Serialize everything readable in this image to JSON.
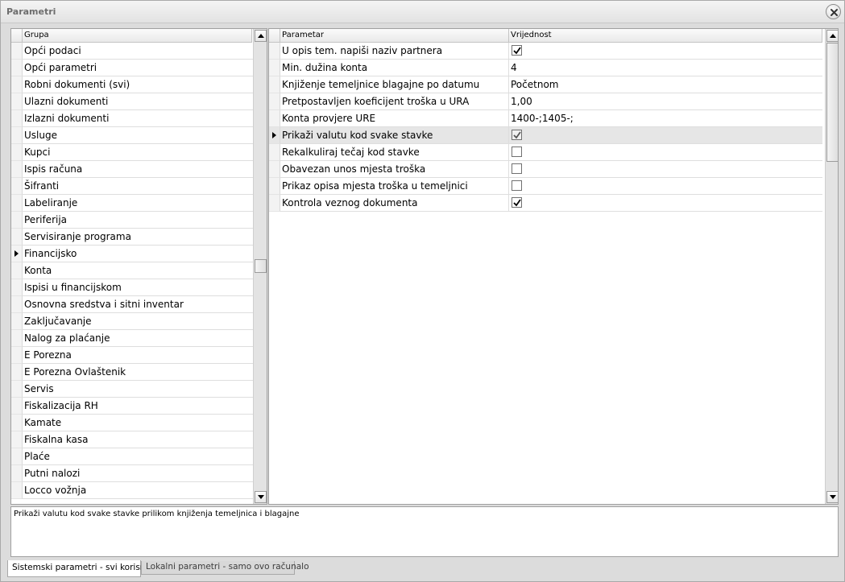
{
  "window": {
    "title": "Parametri"
  },
  "left_grid": {
    "header": "Grupa",
    "selected_index": 13,
    "items": [
      "Opći podaci",
      "Opći parametri",
      "Robni dokumenti (svi)",
      "Ulazni dokumenti",
      "Izlazni dokumenti",
      "Usluge",
      "Kupci",
      "Ispis računa",
      "Šifranti",
      "Labeliranje",
      "Periferija",
      "Servisiranje programa",
      "Financijsko",
      "Konta",
      "Ispisi u financijskom",
      "Osnovna sredstva i sitni inventar",
      "Zaključavanje",
      "Nalog za plaćanje",
      "E Porezna",
      "E Porezna Ovlaštenik",
      "Servis",
      "Fiskalizacija RH",
      "Kamate",
      "Fiskalna kasa",
      "Plaće",
      "Putni nalozi",
      "Locco vožnja"
    ]
  },
  "right_grid": {
    "header_param": "Parametar",
    "header_value": "Vrijednost",
    "selected_index": 5,
    "rows": [
      {
        "param": "U opis tem. napiši naziv partnera",
        "type": "checkbox",
        "checked": true,
        "value": ""
      },
      {
        "param": "Min. dužina konta",
        "type": "text",
        "checked": false,
        "value": "4"
      },
      {
        "param": "Knjiženje temeljnice blagajne po datumu",
        "type": "text",
        "checked": false,
        "value": "Početnom"
      },
      {
        "param": "Pretpostavljen koeficijent troška u URA",
        "type": "text",
        "checked": false,
        "value": "1,00"
      },
      {
        "param": "Konta provjere URE",
        "type": "text",
        "checked": false,
        "value": "1400-;1405-;"
      },
      {
        "param": "Prikaži valutu kod svake stavke",
        "type": "checkbox",
        "checked": true,
        "value": ""
      },
      {
        "param": "Rekalkuliraj tečaj kod stavke",
        "type": "checkbox",
        "checked": false,
        "value": ""
      },
      {
        "param": "Obavezan unos mjesta troška",
        "type": "checkbox",
        "checked": false,
        "value": ""
      },
      {
        "param": "Prikaz opisa mjesta troška u temeljnici",
        "type": "checkbox",
        "checked": false,
        "value": ""
      },
      {
        "param": "Kontrola veznog dokumenta",
        "type": "checkbox",
        "checked": true,
        "value": ""
      }
    ]
  },
  "description": "Prikaži valutu kod svake stavke prilikom knjiženja temeljnica i blagajne",
  "tabs": [
    {
      "label": "Sistemski parametri - svi korisnici",
      "active": true
    },
    {
      "label": "Lokalni parametri - samo ovo računalo",
      "active": false
    }
  ],
  "icons": {
    "close": "close-icon",
    "check": "check-icon",
    "row_pointer": "row-pointer-icon"
  }
}
